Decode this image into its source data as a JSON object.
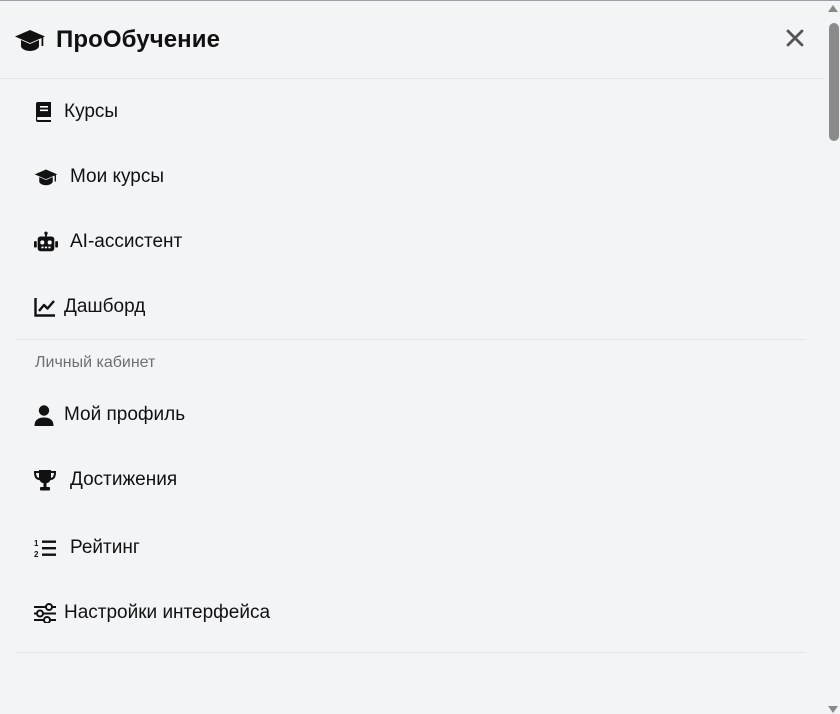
{
  "header": {
    "brand_icon": "graduation-cap-icon",
    "title": "ПроОбучение",
    "close_icon": "close-icon"
  },
  "nav": {
    "main_items": [
      {
        "label": "Курсы",
        "icon": "book-icon"
      },
      {
        "label": "Мои курсы",
        "icon": "graduation-cap-icon"
      },
      {
        "label": "AI-ассистент",
        "icon": "robot-icon"
      },
      {
        "label": "Дашборд",
        "icon": "chart-line-icon"
      }
    ],
    "section_title": "Личный кабинет",
    "account_items": [
      {
        "label": "Мой профиль",
        "icon": "user-icon"
      },
      {
        "label": "Достижения",
        "icon": "trophy-icon"
      },
      {
        "label": "Рейтинг",
        "icon": "ordered-list-icon"
      },
      {
        "label": "Настройки интерфейса",
        "icon": "sliders-icon"
      }
    ]
  },
  "colors": {
    "background": "#f3f4f6",
    "text": "#111111",
    "muted": "#6b7075",
    "divider": "#e1e3e6"
  }
}
